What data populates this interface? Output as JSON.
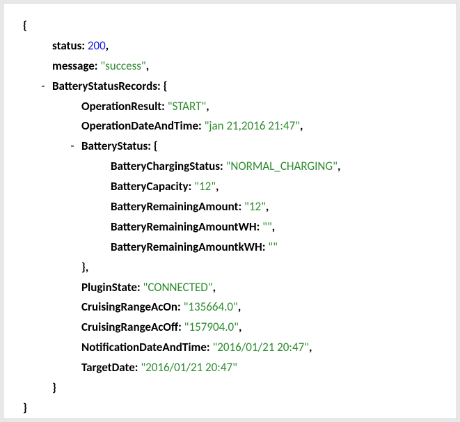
{
  "json": {
    "open_brace": "{",
    "close_brace": "}",
    "comma": ",",
    "colon": ":",
    "collapse_marker": "-",
    "quote": "\"",
    "status_key": "status",
    "status_val": "200",
    "message_key": "message",
    "message_val": "success",
    "bsr_key": "BatteryStatusRecords",
    "op_result_key": "OperationResult",
    "op_result_val": "START",
    "op_datetime_key": "OperationDateAndTime",
    "op_datetime_val": "jan 21,2016 21:47",
    "battery_status_key": "BatteryStatus",
    "charging_status_key": "BatteryChargingStatus",
    "charging_status_val": "NORMAL_CHARGING",
    "capacity_key": "BatteryCapacity",
    "capacity_val": "12",
    "remaining_key": "BatteryRemainingAmount",
    "remaining_val": "12",
    "remaining_wh_key": "BatteryRemainingAmountWH",
    "remaining_wh_val": "",
    "remaining_kwh_key": "BatteryRemainingAmountkWH",
    "remaining_kwh_val": "",
    "plugin_key": "PluginState",
    "plugin_val": "CONNECTED",
    "range_on_key": "CruisingRangeAcOn",
    "range_on_val": "135664.0",
    "range_off_key": "CruisingRangeAcOff",
    "range_off_val": "157904.0",
    "notif_key": "NotificationDateAndTime",
    "notif_val": "2016/01/21 20:47",
    "target_key": "TargetDate",
    "target_val": "2016/01/21 20:47"
  }
}
